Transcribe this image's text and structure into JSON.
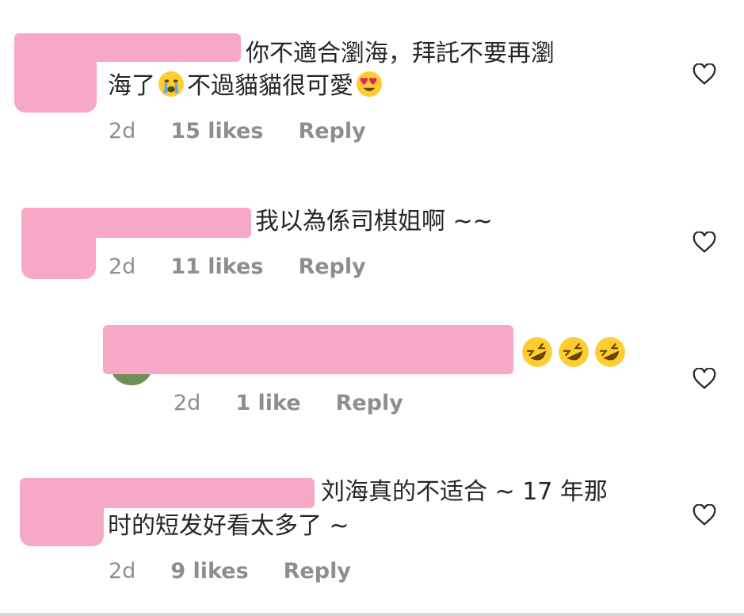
{
  "comments": [
    {
      "line1": "你不適合瀏海，拜託不要再瀏",
      "line2_a": "海了",
      "line2_b": "不過貓貓很可愛",
      "time": "2d",
      "likes": "15 likes",
      "reply": "Reply"
    },
    {
      "line1": "我以為係司棋姐啊 ~~",
      "time": "2d",
      "likes": "11 likes",
      "reply": "Reply"
    },
    {
      "time": "2d",
      "likes": "1 like",
      "reply": "Reply",
      "emoji": "rofl-emoji"
    },
    {
      "line1": "刘海真的不适合 ~ 17 年那",
      "line2": "时的短发好看太多了 ~",
      "time": "2d",
      "likes": "9 likes",
      "reply": "Reply"
    }
  ],
  "colors": {
    "redaction": "#f7a8c7",
    "meta": "#8e8e8e",
    "text": "#262626"
  },
  "icons": {
    "like": "heart-outline-icon"
  }
}
